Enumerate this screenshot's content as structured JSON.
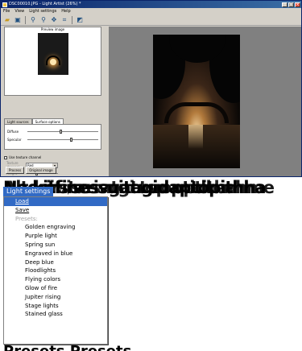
{
  "window": {
    "title": "DSC00010.JPG - Light Artist (26%) *",
    "min": "_",
    "max": "□",
    "close": "×"
  },
  "menubar": [
    "File",
    "View",
    "Light settings",
    "Help"
  ],
  "toolbar": {
    "icons": [
      "open-icon",
      "save-icon",
      "zoom-in-icon",
      "zoom-out-icon",
      "move-icon",
      "fit-icon",
      "view-icon"
    ]
  },
  "preview": {
    "title": "Preview image"
  },
  "tabs": [
    "Light sources",
    "Surface options"
  ],
  "surface": {
    "diffuse_label": "Diffuse",
    "diffuse_value": 0.45,
    "specular_label": "Specular",
    "specular_value": 0.6
  },
  "texture": {
    "use_label": "Use texture channel",
    "channel_label": "Texture channel",
    "channel_value": "Red",
    "height_label": "Height"
  },
  "buttons": {
    "process": "Process",
    "original": "Original image"
  },
  "garbled_heading": [
    "Ne kitfinessuitagidaptopithha",
    "Alterirstarivgatuuoptidharhme",
    "Nedeif isesatgi tsp optitha"
  ],
  "menu": {
    "top_items": [
      "Light settings",
      "Help"
    ],
    "items": [
      {
        "label": "Load",
        "type": "action",
        "highlighted": true
      },
      {
        "label": "Save",
        "type": "action",
        "highlighted": false
      },
      {
        "label": "Presets:",
        "type": "header"
      },
      {
        "label": "Golden engraving",
        "type": "preset"
      },
      {
        "label": "Purple light",
        "type": "preset"
      },
      {
        "label": "Spring sun",
        "type": "preset"
      },
      {
        "label": "Engraved in blue",
        "type": "preset"
      },
      {
        "label": "Deep blue",
        "type": "preset"
      },
      {
        "label": "Floodlights",
        "type": "preset"
      },
      {
        "label": "Flying colors",
        "type": "preset"
      },
      {
        "label": "Glow of fire",
        "type": "preset"
      },
      {
        "label": "Jupiter rising",
        "type": "preset"
      },
      {
        "label": "Stage lights",
        "type": "preset"
      },
      {
        "label": "Stained glass",
        "type": "preset"
      }
    ]
  },
  "bottom_text": "Presets    Presets"
}
